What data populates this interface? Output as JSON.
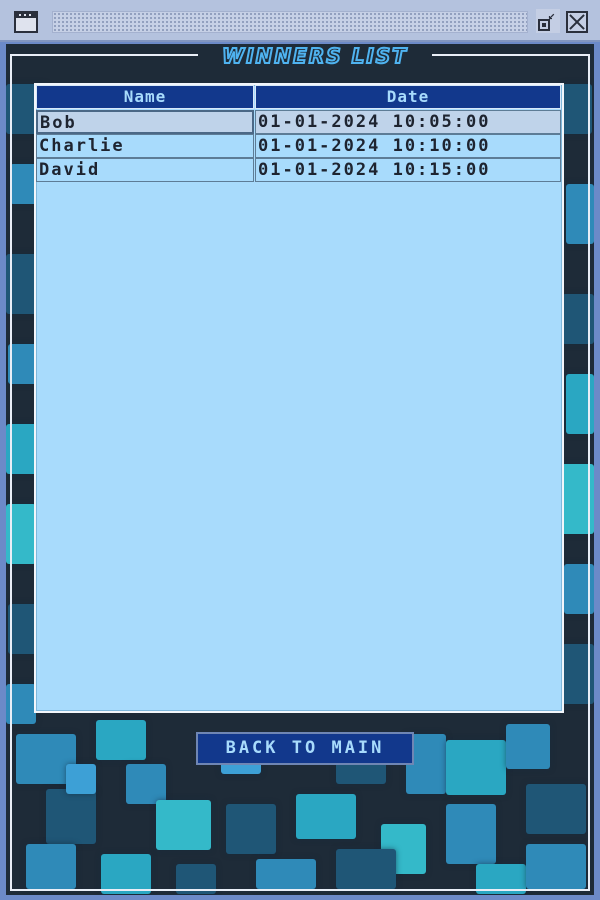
{
  "window": {
    "app_icon": "window-icon",
    "restore_icon": "restore-icon",
    "close_icon": "close-icon"
  },
  "panel": {
    "title": "WINNERS LIST"
  },
  "table": {
    "columns": [
      "Name",
      "Date"
    ],
    "rows": [
      {
        "name": "Bob",
        "date": "01-01-2024 10:05:00",
        "selected": true
      },
      {
        "name": "Charlie",
        "date": "01-01-2024 10:10:00",
        "selected": false
      },
      {
        "name": "David",
        "date": "01-01-2024 10:15:00",
        "selected": false
      }
    ]
  },
  "actions": {
    "back_label": "BACK TO MAIN"
  },
  "colors": {
    "header_bg": "#12388c",
    "table_bg": "#a8dbfc",
    "background": "#1e2b38",
    "title_outline": "#4fb3f0"
  }
}
